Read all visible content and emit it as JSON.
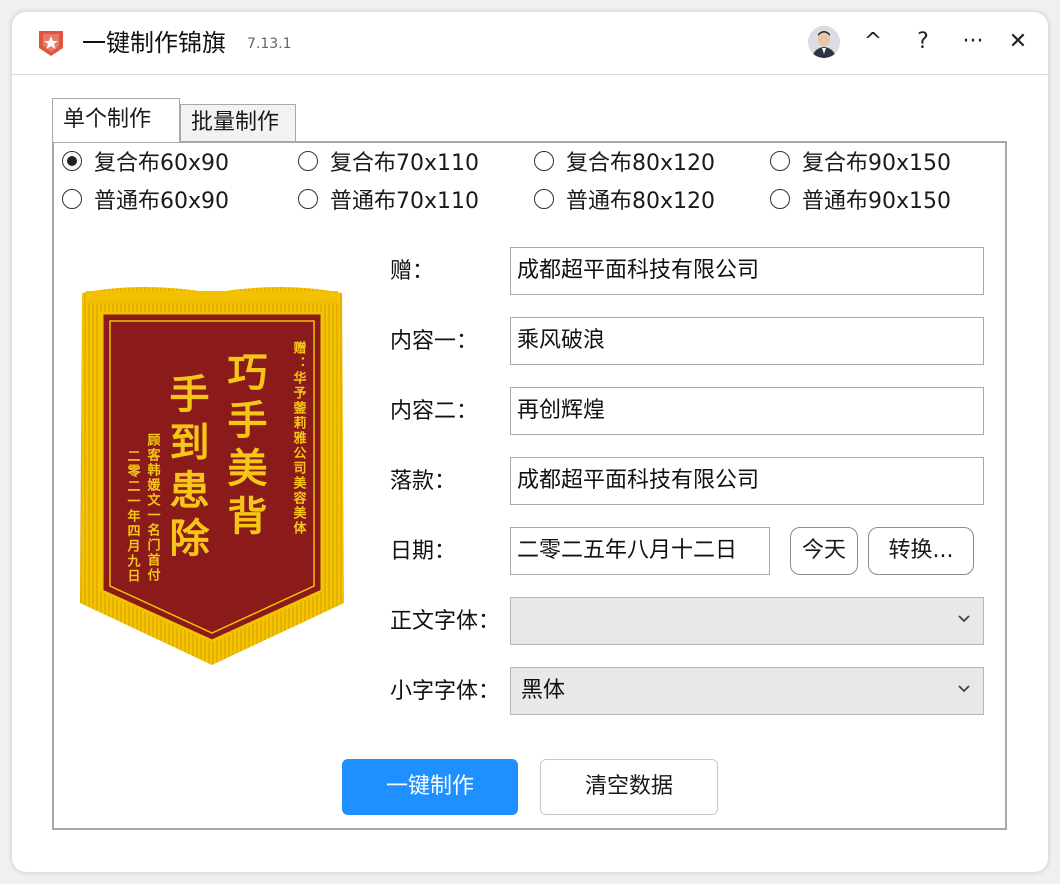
{
  "app": {
    "title": "一键制作锦旗",
    "version": "7.13.1",
    "accent": "#1e90ff",
    "logo_color": "#e0553b"
  },
  "titlebar": {
    "collapse_glyph": "^",
    "help_glyph": "?",
    "more_glyph": "···",
    "close_glyph": "✕"
  },
  "tabs": [
    {
      "label": "单个制作",
      "active": true
    },
    {
      "label": "批量制作",
      "active": false
    }
  ],
  "sizes": {
    "row1": [
      "复合布60x90",
      "复合布70x110",
      "复合布80x120",
      "复合布90x150"
    ],
    "row2": [
      "普通布60x90",
      "普通布70x110",
      "普通布80x120",
      "普通布90x150"
    ],
    "selected": "复合布60x90"
  },
  "preview": {
    "recipient_line": "赠：华予蓥莉雅公司美容美体",
    "main_col1": "巧手美背",
    "main_col2": "手到患除",
    "small_col1": "顾客韩媛文一名门首付",
    "small_col2": "二零二一年四月九日",
    "banner_color": "#8b1a1a",
    "fringe_color": "#f2c200"
  },
  "form": {
    "recipient": {
      "label": "赠：",
      "value": "成都超平面科技有限公司"
    },
    "content1": {
      "label": "内容一：",
      "value": "乘风破浪"
    },
    "content2": {
      "label": "内容二：",
      "value": "再创辉煌"
    },
    "signature": {
      "label": "落款：",
      "value": "成都超平面科技有限公司"
    },
    "date": {
      "label": "日期：",
      "value": "二零二五年八月十二日",
      "today_label": "今天",
      "convert_label": "转换..."
    },
    "body_font": {
      "label": "正文字体：",
      "value": ""
    },
    "small_font": {
      "label": "小字字体：",
      "value": "黑体"
    }
  },
  "actions": {
    "make_label": "一键制作",
    "clear_label": "清空数据"
  }
}
